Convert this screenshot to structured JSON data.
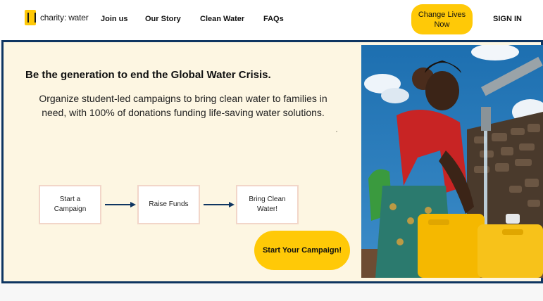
{
  "brand": {
    "name": "charity: water",
    "logo_icon": "jerrycan-logo-icon",
    "accent": "#ffc907",
    "navy": "#0e3561"
  },
  "nav": {
    "links": [
      "Join us",
      "Our Story",
      "Clean Water",
      "FAQs"
    ],
    "cta": "Change Lives Now",
    "signin": "SIGN IN"
  },
  "hero": {
    "headline": "Be the generation to end the Global Water Crisis.",
    "subtext": "Organize student-led campaigns to bring clean water to families in need, with 100% of donations funding life-saving water solutions.",
    "steps": [
      "Start a Campaign",
      "Raise Funds",
      "Bring Clean Water!"
    ],
    "cta": "Start Your Campaign!",
    "background": "#fdf6e2"
  }
}
